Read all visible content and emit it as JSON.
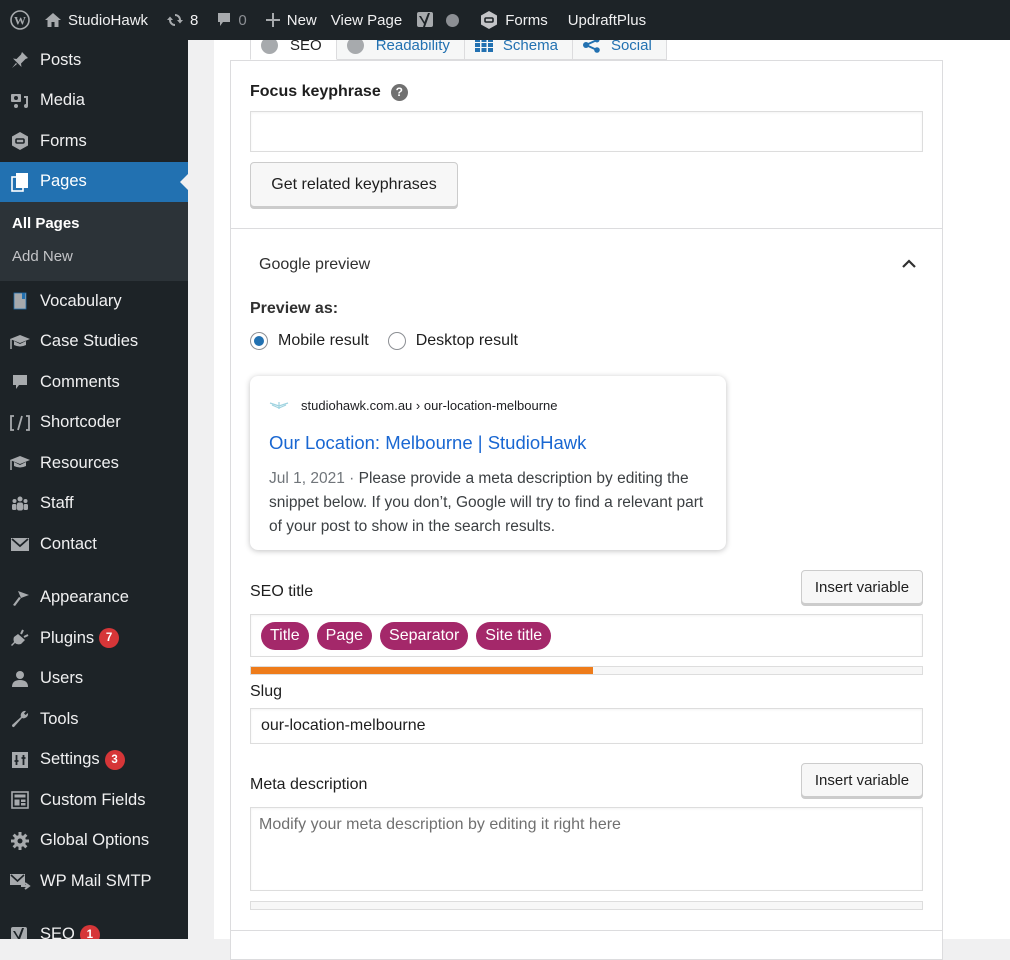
{
  "adminbar": {
    "site_name": "StudioHawk",
    "updates_count": "8",
    "comments_count": "0",
    "new_label": "New",
    "view_page_label": "View Page",
    "forms_label": "Forms",
    "updraft_label": "UpdraftPlus"
  },
  "sidebar": {
    "items_top": [
      {
        "label": "Posts",
        "icon": "pin-icon"
      },
      {
        "label": "Media",
        "icon": "media-icon"
      },
      {
        "label": "Forms",
        "icon": "forms-icon"
      },
      {
        "label": "Pages",
        "icon": "pages-icon",
        "current": true
      }
    ],
    "submenu": [
      {
        "label": "All Pages",
        "active": true
      },
      {
        "label": "Add New",
        "active": false
      }
    ],
    "items_mid": [
      {
        "label": "Vocabulary",
        "icon": "book-icon"
      },
      {
        "label": "Case Studies",
        "icon": "graduation-cap-icon"
      },
      {
        "label": "Comments",
        "icon": "comment-icon"
      },
      {
        "label": "Shortcoder",
        "icon": "shortcode-icon"
      },
      {
        "label": "Resources",
        "icon": "graduation-cap-icon"
      },
      {
        "label": "Staff",
        "icon": "groups-icon"
      },
      {
        "label": "Contact",
        "icon": "email-icon"
      }
    ],
    "items_bottom": [
      {
        "label": "Appearance",
        "icon": "brush-icon"
      },
      {
        "label": "Plugins",
        "icon": "plugin-icon",
        "badge": "7"
      },
      {
        "label": "Users",
        "icon": "user-icon"
      },
      {
        "label": "Tools",
        "icon": "wrench-icon"
      },
      {
        "label": "Settings",
        "icon": "settings-icon",
        "badge": "3"
      },
      {
        "label": "Custom Fields",
        "icon": "custom-fields-icon"
      },
      {
        "label": "Global Options",
        "icon": "gear-icon"
      },
      {
        "label": "WP Mail SMTP",
        "icon": "mail-forward-icon"
      }
    ],
    "seo": {
      "label": "SEO",
      "icon": "yoast-icon",
      "badge": "1"
    }
  },
  "tabs": [
    {
      "label": "SEO",
      "active": true
    },
    {
      "label": "Readability",
      "active": false
    },
    {
      "label": "Schema",
      "active": false
    },
    {
      "label": "Social",
      "active": false
    }
  ],
  "seo": {
    "focus_keyphrase_label": "Focus keyphrase",
    "focus_keyphrase_value": "",
    "help_glyph": "?",
    "related_button": "Get related keyphrases",
    "google_preview_label": "Google preview",
    "preview_as_label": "Preview as:",
    "preview_options": [
      {
        "label": "Mobile result",
        "checked": true
      },
      {
        "label": "Desktop result",
        "checked": false
      }
    ],
    "serp": {
      "url": "studiohawk.com.au › our-location-melbourne",
      "title": "Our Location: Melbourne | StudioHawk",
      "date": "Jul 1, 2021",
      "separator": " · ",
      "description": "Please provide a meta description by editing the snippet below. If you don’t, Google will try to find a relevant part of your post to show in the search results."
    },
    "seo_title_label": "SEO title",
    "insert_variable_label": "Insert variable",
    "seo_title_chips": [
      "Title",
      "Page",
      "Separator",
      "Site title"
    ],
    "seo_title_progress_percent": 51,
    "slug_label": "Slug",
    "slug_value": "our-location-melbourne",
    "meta_description_label": "Meta description",
    "meta_description_placeholder": "Modify your meta description by editing it right here",
    "meta_description_progress_percent": 0
  },
  "colors": {
    "admin_dark": "#1d2327",
    "accent_blue": "#2271b1",
    "chip_purple": "#a4286a",
    "progress_orange": "#ee7c1b",
    "badge_red": "#d63638"
  }
}
